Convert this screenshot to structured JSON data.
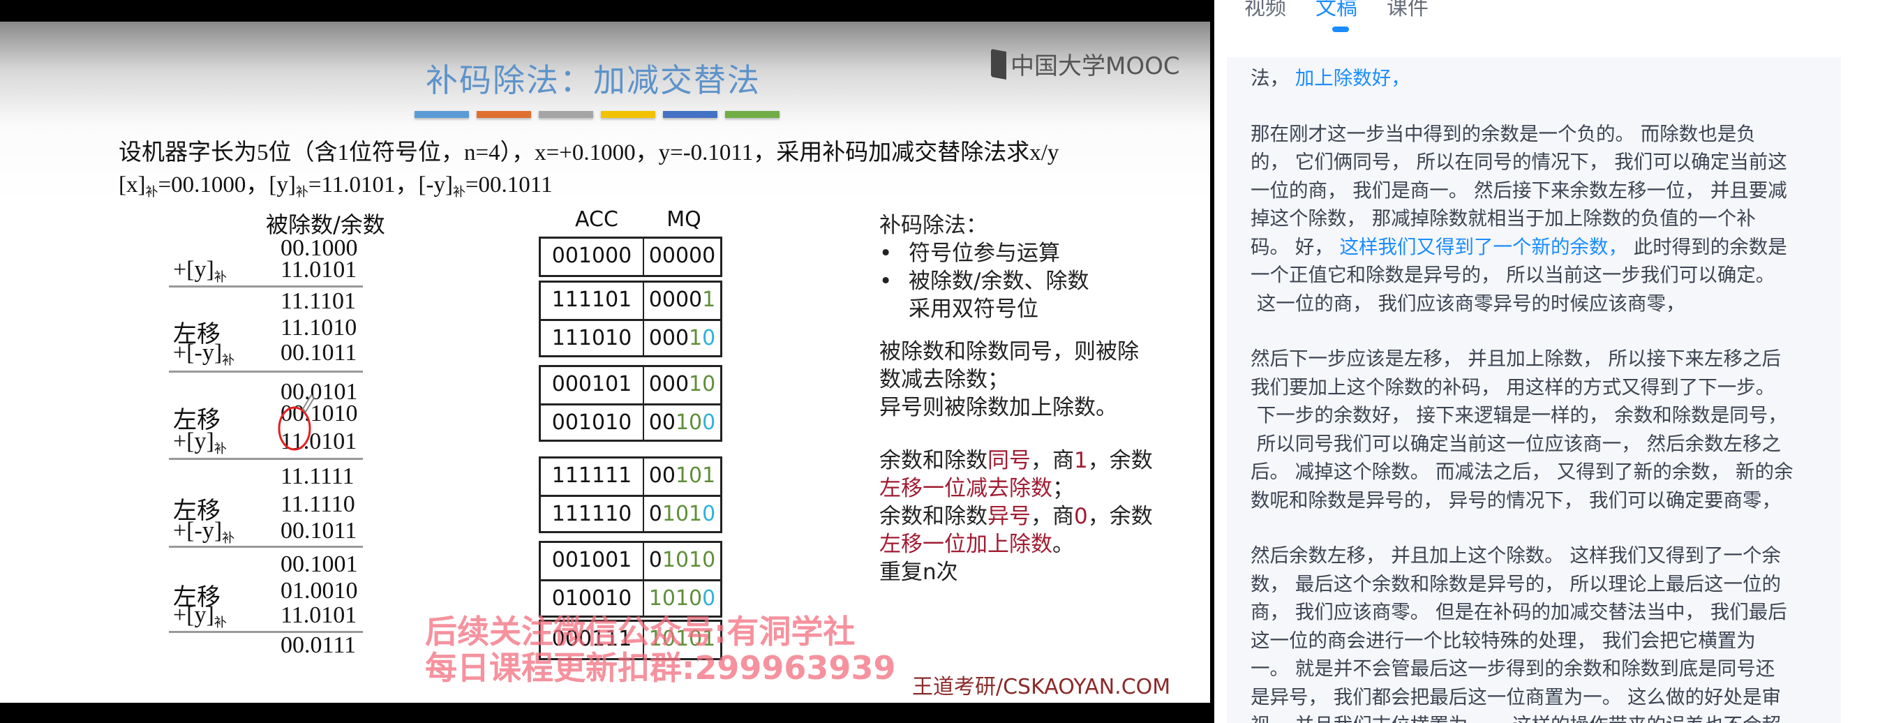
{
  "slide": {
    "title": "补码除法：加减交替法",
    "logo_text": "中国大学MOOC",
    "bar_colors": [
      "#5b9bd5",
      "#e07030",
      "#a5a5a5",
      "#f2c200",
      "#4472c4",
      "#70ad47"
    ],
    "problem_line1": "设机器字长为5位（含1位符号位，n=4），x=+0.1000，y=-0.1011，采用补码加减交替除法求x/y",
    "problem_line2": [
      {
        "t": "[x]"
      },
      {
        "sub": "补"
      },
      {
        "t": "=00.1000，[y]"
      },
      {
        "sub": "补"
      },
      {
        "t": "=11.0101，[-y]"
      },
      {
        "sub": "补"
      },
      {
        "t": "=00.1011"
      }
    ],
    "dividend_header": "被除数/余数",
    "dividend_rows": [
      {
        "label": "",
        "value": "00.1000"
      },
      {
        "label": "+[y]",
        "sub": "补",
        "value": "11.0101"
      },
      {
        "label": "",
        "value": "11.1101"
      },
      {
        "label": "左移",
        "value": "11.1010"
      },
      {
        "label": "+[-y]",
        "sub": "补",
        "value": "00.1011"
      },
      {
        "label": "",
        "value": "00.0101"
      },
      {
        "label": "左移",
        "value": "00.1010"
      },
      {
        "label": "+[y]",
        "sub": "补",
        "value": "11.0101"
      },
      {
        "label": "",
        "value": "11.1111"
      },
      {
        "label": "左移",
        "value": "11.1110"
      },
      {
        "label": "+[-y]",
        "sub": "补",
        "value": "00.1011"
      },
      {
        "label": "",
        "value": "00.1001"
      },
      {
        "label": "左移",
        "value": "01.0010"
      },
      {
        "label": "+[y]",
        "sub": "补",
        "value": "11.0101"
      },
      {
        "label": "",
        "value": "00.0111"
      }
    ],
    "acc_header": "ACC",
    "mq_header": "MQ",
    "register_groups": [
      [
        {
          "acc": "001000",
          "mq": [
            [
              "00000",
              "k"
            ]
          ]
        }
      ],
      [
        {
          "acc": "111101",
          "mq": [
            [
              "0000",
              "k"
            ],
            [
              "1",
              "g"
            ]
          ]
        },
        {
          "acc": "111010",
          "mq": [
            [
              "000",
              "k"
            ],
            [
              "1",
              "g"
            ],
            [
              "0",
              "c"
            ]
          ]
        }
      ],
      [
        {
          "acc": "000101",
          "mq": [
            [
              "000",
              "k"
            ],
            [
              "10",
              "g"
            ]
          ]
        },
        {
          "acc": "001010",
          "mq": [
            [
              "00",
              "k"
            ],
            [
              "10",
              "g"
            ],
            [
              "0",
              "c"
            ]
          ]
        }
      ],
      [
        {
          "acc": "111111",
          "mq": [
            [
              "00",
              "k"
            ],
            [
              "101",
              "g"
            ]
          ]
        },
        {
          "acc": "111110",
          "mq": [
            [
              "0",
              "k"
            ],
            [
              "101",
              "g"
            ],
            [
              "0",
              "c"
            ]
          ]
        }
      ],
      [
        {
          "acc": "001001",
          "mq": [
            [
              "0",
              "k"
            ],
            [
              "1010",
              "g"
            ]
          ]
        },
        {
          "acc": "010010",
          "mq": [
            [
              "1010",
              "g"
            ],
            [
              "0",
              "c"
            ]
          ]
        }
      ],
      [
        {
          "acc": "000111",
          "mq": [
            [
              "10101",
              "g"
            ]
          ]
        }
      ]
    ],
    "notes": [
      [
        [
          "补码除法：",
          ""
        ]
      ],
      [
        [
          "•",
          "bullet"
        ],
        [
          "符号位参与运算",
          ""
        ]
      ],
      [
        [
          "•",
          "bullet"
        ],
        [
          "被除数/余数、除数",
          ""
        ]
      ],
      [
        [
          "",
          "bullet"
        ],
        [
          "采用双符号位",
          ""
        ]
      ],
      [
        [
          "被除数和除数同号，则被除",
          ""
        ]
      ],
      [
        [
          "数减去除数；",
          ""
        ]
      ],
      [
        [
          "异号则被除数加上除数。",
          ""
        ]
      ],
      [
        [
          "余数和除数",
          ""
        ],
        [
          "同号",
          "red"
        ],
        [
          "，商",
          ""
        ],
        [
          "1",
          "red"
        ],
        [
          "，余数",
          ""
        ]
      ],
      [
        [
          "左移一位减去除数",
          "red"
        ],
        [
          "；",
          ""
        ]
      ],
      [
        [
          "余数和除数",
          ""
        ],
        [
          "异号",
          "red"
        ],
        [
          "，商",
          ""
        ],
        [
          "0",
          "red"
        ],
        [
          "，余数",
          ""
        ]
      ],
      [
        [
          "左移一位加上除数",
          "red"
        ],
        [
          "。",
          ""
        ]
      ],
      [
        [
          "重复n次",
          ""
        ]
      ]
    ],
    "watermark_line1": "后续关注微信公众号:有洞学社",
    "watermark_line2": "每日课程更新扣群:299963939",
    "footer": "王道考研/CSKAOYAN.COM",
    "colors": {
      "mq_new_bit": "#5f8f3a",
      "mq_shift_bit": "#2eb2db",
      "rule_highlight": "#a01c32",
      "annotation_circle": "#e02020"
    }
  },
  "panel": {
    "tabs": [
      {
        "label": "视频"
      },
      {
        "label": "文稿",
        "active": true
      },
      {
        "label": "课件"
      }
    ],
    "accent": "#1a8cff",
    "paragraphs": [
      [
        [
          [
            "法， ",
            ""
          ],
          [
            "加上除数好，",
            "hl"
          ]
        ]
      ],
      [
        [
          [
            "那在刚才这一步当中得到的余数是一个负的。 而除数也是负",
            ""
          ]
        ],
        [
          [
            "的， 它们俩同号， 所以在同号的情况下， 我们可以确定当前这",
            ""
          ]
        ],
        [
          [
            "一位的商， 我们是商一。 然后接下来余数左移一位， 并且要减",
            ""
          ]
        ],
        [
          [
            "掉这个除数， 那减掉除数就相当于加上除数的负值的一个补",
            ""
          ]
        ],
        [
          [
            "码。 好， ",
            ""
          ],
          [
            "这样我们又得到了一个新的余数，",
            "hl"
          ],
          [
            " 此时得到的余数是",
            ""
          ]
        ],
        [
          [
            "一个正值它和除数是异号的， 所以当前这一步我们可以确定。",
            ""
          ]
        ],
        [
          [
            " 这一位的商， 我们应该商零异号的时候应该商零，",
            ""
          ]
        ]
      ],
      [
        [
          [
            "然后下一步应该是左移， 并且加上除数， 所以接下来左移之后",
            ""
          ]
        ],
        [
          [
            "我们要加上这个除数的补码， 用这样的方式又得到了下一步。",
            ""
          ]
        ],
        [
          [
            " 下一步的余数好， 接下来逻辑是一样的， 余数和除数是同号，",
            ""
          ]
        ],
        [
          [
            " 所以同号我们可以确定当前这一位应该商一， 然后余数左移之",
            ""
          ]
        ],
        [
          [
            "后。 减掉这个除数。 而减法之后， 又得到了新的余数， 新的余",
            ""
          ]
        ],
        [
          [
            "数呢和除数是异号的， 异号的情况下， 我们可以确定要商零，",
            ""
          ]
        ]
      ],
      [
        [
          [
            "然后余数左移， 并且加上这个除数。 这样我们又得到了一个余",
            ""
          ]
        ],
        [
          [
            "数， 最后这个余数和除数是异号的， 所以理论上最后这一位的",
            ""
          ]
        ],
        [
          [
            "商， 我们应该商零。 但是在补码的加减交替法当中， 我们最后",
            ""
          ]
        ],
        [
          [
            "这一位的商会进行一个比较特殊的处理， 我们会把它横置为",
            ""
          ]
        ],
        [
          [
            "一。 就是并不会管最后这一步得到的余数和除数到底是同号还",
            ""
          ]
        ],
        [
          [
            "是异号， 我们都会把最后这一位商置为一。 这么做的好处是审",
            ""
          ]
        ],
        [
          [
            "视， 并且我们末位横置为一， 这样的操作带来的误差也不会超",
            ""
          ]
        ]
      ]
    ]
  }
}
